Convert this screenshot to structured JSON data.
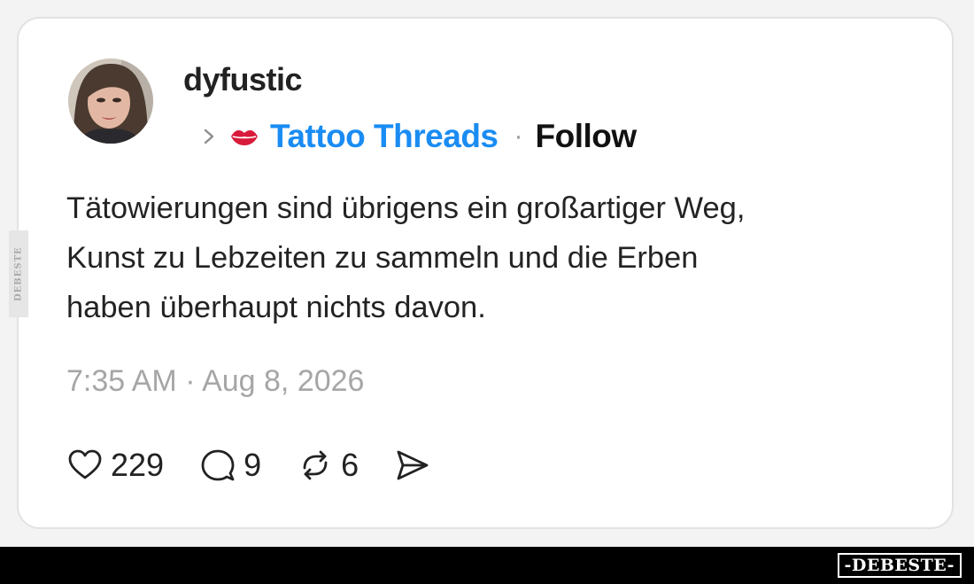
{
  "post": {
    "username": "dyfustic",
    "community": "Tattoo Threads",
    "separator": "·",
    "follow_label": "Follow",
    "text_lines": [
      "Tätowierungen sind übrigens ein großartiger Weg,",
      "Kunst zu Lebzeiten zu sammeln und die Erben",
      "haben überhaupt nichts davon."
    ],
    "timestamp": "7:35 AM · Aug 8, 2026"
  },
  "actions": {
    "likes": "229",
    "replies": "9",
    "reposts": "6"
  },
  "icons": {
    "avatar": "profile-photo",
    "breadcrumb": "chevron-right-icon",
    "community": "lips-icon",
    "like": "heart-icon",
    "reply": "speech-bubble-icon",
    "repost": "repost-arrows-icon",
    "share": "send-arrow-icon"
  },
  "colors": {
    "community_link": "#1a8cf3",
    "timestamp": "#a6a6a6",
    "text": "#232323",
    "lips": "#d81b3a"
  },
  "watermarks": {
    "side": "DEBESTE",
    "bottom": "-DEBESTE-"
  }
}
